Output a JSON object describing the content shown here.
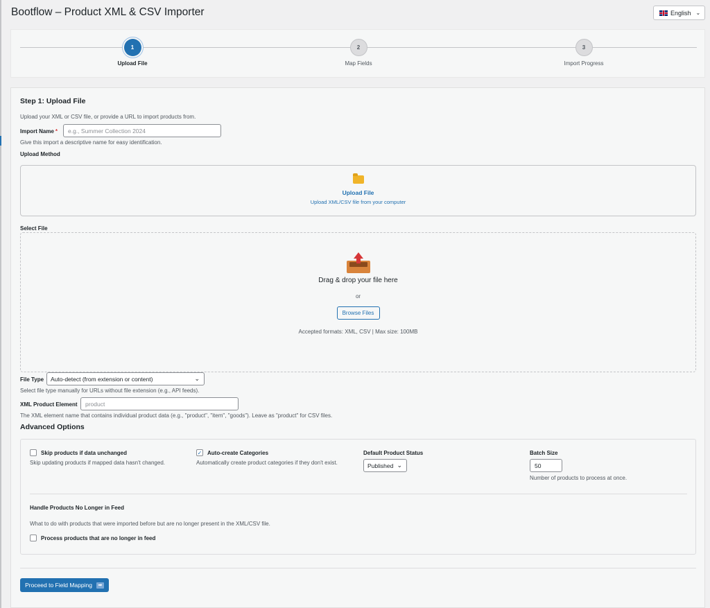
{
  "app": {
    "title": "Bootflow – Product XML & CSV Importer"
  },
  "language": {
    "label": "English",
    "flag_icon": "uk-flag-icon"
  },
  "steps": [
    {
      "number": "1",
      "label": "Upload File",
      "active": true
    },
    {
      "number": "2",
      "label": "Map Fields",
      "active": false
    },
    {
      "number": "3",
      "label": "Import Progress",
      "active": false
    }
  ],
  "step1": {
    "title": "Step 1: Upload File",
    "description": "Upload your XML or CSV file, or provide a URL to import products from."
  },
  "import_name": {
    "label": "Import Name",
    "required_marker": "*",
    "placeholder": "e.g., Summer Collection 2024",
    "help": "Give this import a descriptive name for easy identification."
  },
  "upload_method": {
    "label": "Upload Method",
    "option_title": "Upload File",
    "option_desc": "Upload XML/CSV file from your computer"
  },
  "select_file": {
    "label": "Select File",
    "drop_text": "Drag & drop your file here",
    "or_text": "or",
    "browse_label": "Browse Files",
    "accepted": "Accepted formats: XML, CSV | Max size: 100MB"
  },
  "file_type": {
    "label": "File Type",
    "value": "Auto-detect (from extension or content)",
    "help": "Select file type manually for URLs without file extension (e.g., API feeds)."
  },
  "xml_element": {
    "label": "XML Product Element",
    "value": "product",
    "help": "The XML element name that contains individual product data (e.g., \"product\", \"item\", \"goods\"). Leave as \"product\" for CSV files."
  },
  "advanced": {
    "title": "Advanced Options",
    "skip_unchanged": {
      "label": "Skip products if data unchanged",
      "help": "Skip updating products if mapped data hasn't changed.",
      "checked": false
    },
    "auto_categories": {
      "label": "Auto-create Categories",
      "help": "Automatically create product categories if they don't exist.",
      "checked": true
    },
    "default_status": {
      "label": "Default Product Status",
      "value": "Published"
    },
    "batch_size": {
      "label": "Batch Size",
      "value": "50",
      "help": "Number of products to process at once."
    },
    "no_longer_feed": {
      "title": "Handle Products No Longer in Feed",
      "help": "What to do with products that were imported before but are no longer present in the XML/CSV file.",
      "checkbox_label": "Process products that are no longer in feed",
      "checked": false
    }
  },
  "proceed": {
    "label": "Proceed to Field Mapping",
    "icon": "arrow-right-icon"
  }
}
